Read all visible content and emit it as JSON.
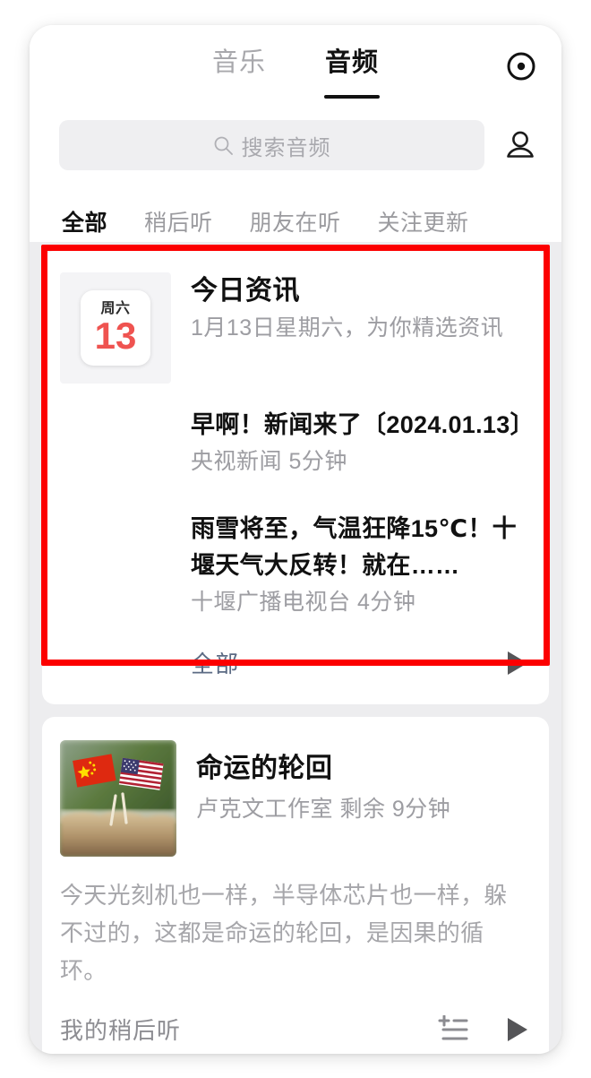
{
  "header": {
    "tabs": [
      {
        "label": "音乐",
        "active": false
      },
      {
        "label": "音频",
        "active": true
      }
    ],
    "record_icon": "record-circle-icon"
  },
  "search": {
    "placeholder": "搜索音频",
    "icon": "search-icon",
    "profile_icon": "person-icon"
  },
  "filters": [
    {
      "label": "全部",
      "active": true
    },
    {
      "label": "稍后听",
      "active": false
    },
    {
      "label": "朋友在听",
      "active": false
    },
    {
      "label": "关注更新",
      "active": false
    }
  ],
  "cards": {
    "today_news": {
      "calendar": {
        "weekday": "周六",
        "day": "13"
      },
      "title": "今日资讯",
      "subtitle": "1月13日星期六，为你精选资讯",
      "items": [
        {
          "title": "早啊！新闻来了〔2024.01.13〕",
          "meta": "央视新闻 5分钟"
        },
        {
          "title": "雨雪将至，气温狂降15℃！十堰天气大反转！就在……",
          "meta": "十堰广播电视台 4分钟"
        }
      ],
      "footer_link": "全部",
      "play_icon": "play-triangle-icon",
      "highlight_color": "#fc0000"
    },
    "podcast": {
      "thumbnail": "china-us-flags-image",
      "title": "命运的轮回",
      "meta": "卢克文工作室 剩余 9分钟",
      "description": "今天光刻机也一样，半导体芯片也一样，躲不过的，这都是命运的轮回，是因果的循环。",
      "footer_label": "我的稍后听",
      "addlist_icon": "playlist-add-icon",
      "play_icon": "play-triangle-icon"
    }
  },
  "colors": {
    "accent_red": "#ef5350",
    "link_blue": "#5c6b84",
    "highlight": "#fc0000"
  }
}
